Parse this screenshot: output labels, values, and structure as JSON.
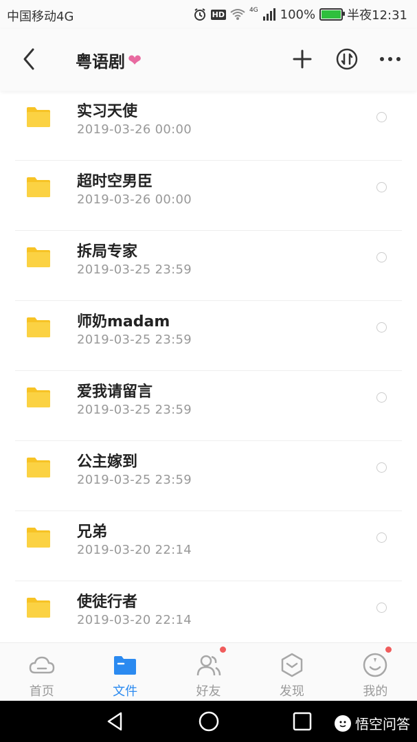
{
  "status_bar": {
    "carrier": "中国移动4G",
    "network_badge": "4G",
    "hd_badge": "HD",
    "battery_percent": "100%",
    "battery_level": 1.0,
    "time": "半夜12:31"
  },
  "title_bar": {
    "title": "粤语剧",
    "heart": "❤"
  },
  "files": [
    {
      "name": "实习天使",
      "date": "2019-03-26  00:00"
    },
    {
      "name": "超时空男臣",
      "date": "2019-03-26  00:00"
    },
    {
      "name": "拆局专家",
      "date": "2019-03-25  23:59"
    },
    {
      "name": "师奶madam",
      "date": "2019-03-25  23:59"
    },
    {
      "name": "爱我请留言",
      "date": "2019-03-25  23:59"
    },
    {
      "name": "公主嫁到",
      "date": "2019-03-25  23:59"
    },
    {
      "name": "兄弟",
      "date": "2019-03-20  22:14"
    },
    {
      "name": "使徒行者",
      "date": "2019-03-20  22:14"
    }
  ],
  "tabs": [
    {
      "label": "首页",
      "icon": "cloud-icon"
    },
    {
      "label": "文件",
      "icon": "folder-icon",
      "active": true
    },
    {
      "label": "好友",
      "icon": "friends-icon",
      "badge": true
    },
    {
      "label": "发现",
      "icon": "discover-icon"
    },
    {
      "label": "我的",
      "icon": "profile-icon",
      "badge": true
    }
  ],
  "watermark": {
    "text": "悟空问答"
  },
  "colors": {
    "accent": "#2b8af0",
    "folder": "#f7c325",
    "badge": "#f05c5c",
    "heart": "#e86aa0"
  }
}
